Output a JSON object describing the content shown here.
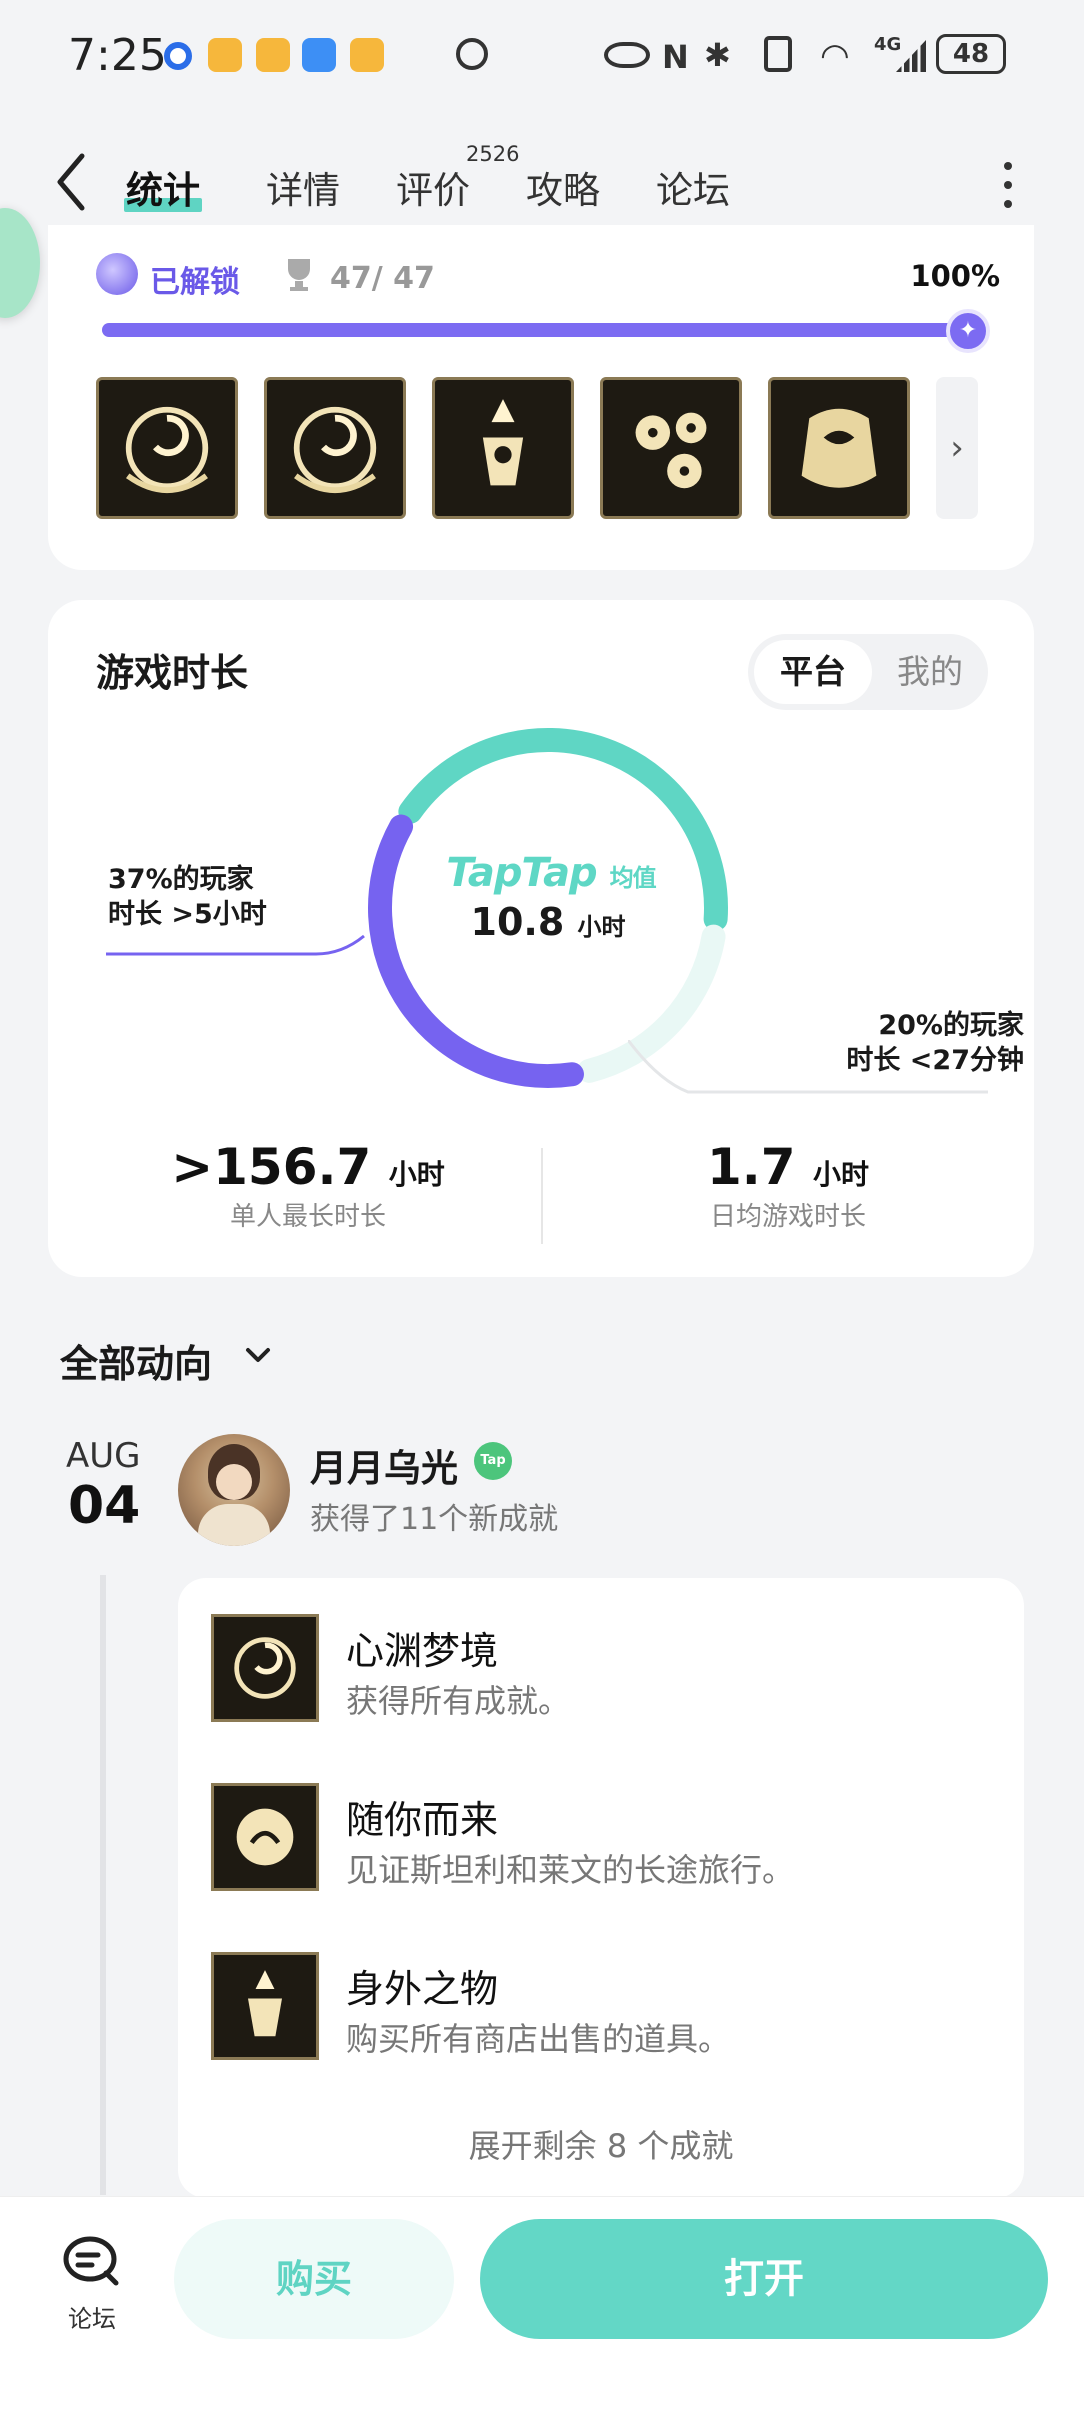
{
  "status_bar": {
    "time": "7:25",
    "battery": "48",
    "network": "4G"
  },
  "header": {
    "tabs": [
      {
        "label": "统计",
        "active": true
      },
      {
        "label": "详情",
        "active": false
      },
      {
        "label": "评价",
        "active": false,
        "badge": "2526"
      },
      {
        "label": "攻略",
        "active": false
      },
      {
        "label": "论坛",
        "active": false
      }
    ]
  },
  "achievements": {
    "unlocked_label": "已解锁",
    "count": "47/ 47",
    "percent": "100%",
    "progress_fraction": 1.0
  },
  "playtime": {
    "title": "游戏时长",
    "toggle": {
      "platform": "平台",
      "mine": "我的"
    },
    "brand": "TapTap",
    "brand_suffix": "均值",
    "average": "10.8",
    "average_unit": "小时",
    "left_note_line1": "37%的玩家",
    "left_note_line2": "时长 >5小时",
    "right_note_line1": "20%的玩家",
    "right_note_line2": "时长 <27分钟",
    "max_value": ">156.7",
    "max_unit": "小时",
    "max_label": "单人最长时长",
    "daily_value": "1.7",
    "daily_unit": "小时",
    "daily_label": "日均游戏时长",
    "segments": {
      "over_5h": 0.37,
      "under_27m": 0.2,
      "other": 0.43
    },
    "colors": {
      "over_5h": "#7663f0",
      "middle": "#5fd6c4",
      "under_27m": "#e9f8f5"
    }
  },
  "feed": {
    "filter_label": "全部动向",
    "date_month": "AUG",
    "date_day": "04",
    "user_name": "月月乌光",
    "action": "获得了11个新成就",
    "items": [
      {
        "name": "心渊梦境",
        "desc": "获得所有成就。"
      },
      {
        "name": "随你而来",
        "desc": "见证斯坦利和莱文的长途旅行。"
      },
      {
        "name": "身外之物",
        "desc": "购买所有商店出售的道具。"
      }
    ],
    "expand_label": "展开剩余 8 个成就"
  },
  "bottom_bar": {
    "forum_label": "论坛",
    "buy_label": "购买",
    "open_label": "打开"
  },
  "colors": {
    "accent": "#5fd4c3",
    "purple": "#7663f0"
  }
}
